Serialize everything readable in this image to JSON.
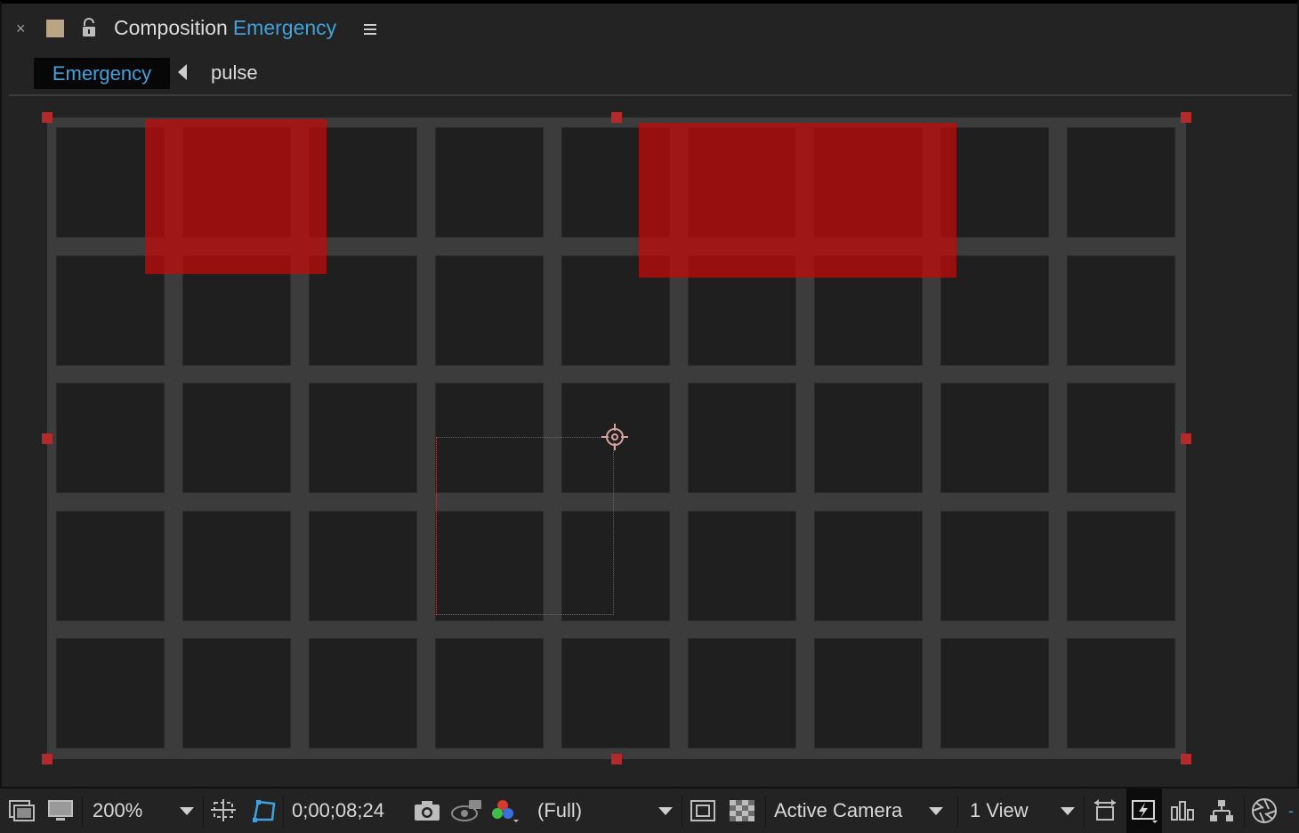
{
  "header": {
    "close_glyph": "×",
    "title_prefix": "Composition",
    "title_name": "Emergency",
    "label_color": "#b9a484",
    "accent_color": "#3fa2dd",
    "icons": [
      "close-icon",
      "label-color-swatch",
      "lock-icon",
      "panel-menu-icon"
    ]
  },
  "breadcrumb": {
    "active": "Emergency",
    "items": [
      "pulse"
    ]
  },
  "viewer": {
    "comp_background": "#3c3c3c",
    "cell_color": "#1f1f1f",
    "grid_columns": 9,
    "grid_rows": 5,
    "layer_color": "#c80a0a",
    "handle_color": "#b42a2a"
  },
  "toolbar": {
    "magnification": "200%",
    "timecode": "0;00;08;24",
    "resolution": "(Full)",
    "camera": "Active Camera",
    "views": "1 View",
    "icons": [
      "always-preview-icon",
      "display-icon",
      "region-of-interest-icon",
      "toggle-mask-icon",
      "snapshot-icon",
      "show-snapshot-icon",
      "channel-icon",
      "toggle-transparency-grid-icon",
      "safe-zones-icon",
      "pixel-aspect-icon",
      "fast-previews-icon",
      "timeline-icon",
      "flowchart-icon",
      "exposure-icon"
    ]
  }
}
